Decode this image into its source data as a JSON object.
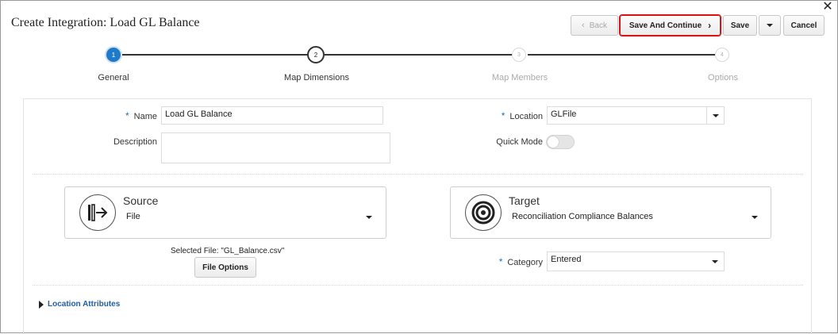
{
  "header": {
    "title": "Create Integration: Load GL Balance",
    "close_icon": "✕"
  },
  "toolbar": {
    "back_label": "Back",
    "save_continue_label": "Save And Continue",
    "save_label": "Save",
    "cancel_label": "Cancel"
  },
  "train": {
    "steps": [
      {
        "number": "1",
        "label": "General",
        "state": "active"
      },
      {
        "number": "2",
        "label": "Map Dimensions",
        "state": "visited"
      },
      {
        "number": "3",
        "label": "Map Members",
        "state": "pending"
      },
      {
        "number": "4",
        "label": "Options",
        "state": "pending"
      }
    ]
  },
  "form": {
    "required_marker": "*",
    "name_label": "Name",
    "name_value": "Load GL Balance",
    "description_label": "Description",
    "description_value": "",
    "location_label": "Location",
    "location_value": "GLFile",
    "quick_mode_label": "Quick Mode",
    "quick_mode_on": false
  },
  "source": {
    "title": "Source",
    "value": "File",
    "icon": "source-arrow-icon",
    "selected_file_text": "Selected File: \"GL_Balance.csv\"",
    "file_options_label": "File Options"
  },
  "target": {
    "title": "Target",
    "value": "Reconciliation Compliance Balances",
    "icon": "target-bullseye-icon",
    "category_label": "Category",
    "category_value": "Entered"
  },
  "location_attributes": {
    "label": "Location Attributes"
  },
  "colors": {
    "accent": "#1f7bc9",
    "highlight_border": "#dd1111",
    "link": "#1f5ea8"
  }
}
